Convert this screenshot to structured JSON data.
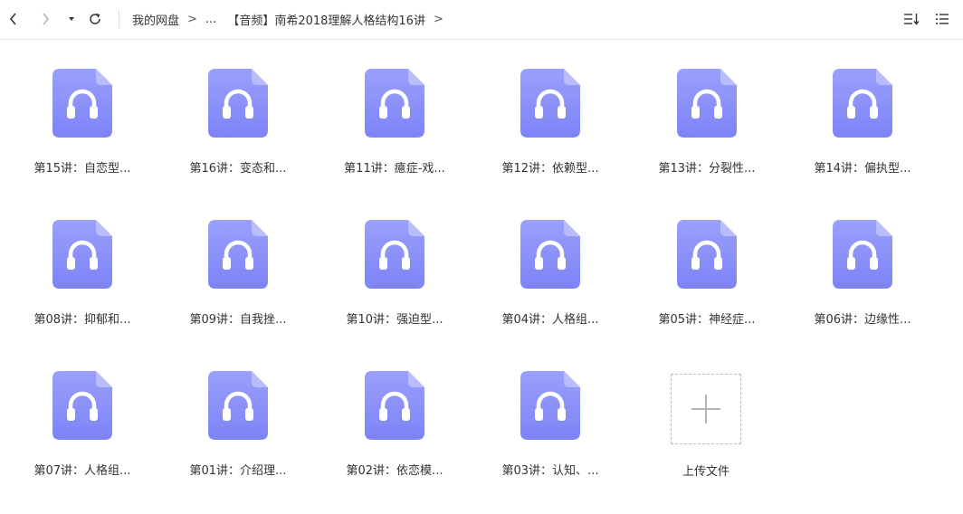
{
  "toolbar": {
    "back_icon": "chevron-left-icon",
    "forward_icon": "chevron-right-icon",
    "dropdown_icon": "caret-down-icon",
    "refresh_icon": "refresh-icon",
    "sort_icon": "sort-icon",
    "view_icon": "list-view-icon"
  },
  "breadcrumb": {
    "root": "我的网盘",
    "separator": ">",
    "ellipsis": "...",
    "current": "【音频】南希2018理解人格结构16讲"
  },
  "files": [
    {
      "name": "第15讲：自恋型..."
    },
    {
      "name": "第16讲：变态和..."
    },
    {
      "name": "第11讲：癔症-戏..."
    },
    {
      "name": "第12讲：依赖型..."
    },
    {
      "name": "第13讲：分裂性..."
    },
    {
      "name": "第14讲：偏执型..."
    },
    {
      "name": "第08讲：抑郁和..."
    },
    {
      "name": "第09讲：自我挫..."
    },
    {
      "name": "第10讲：强迫型..."
    },
    {
      "name": "第04讲：人格组..."
    },
    {
      "name": "第05讲：神经症..."
    },
    {
      "name": "第06讲：边缘性..."
    },
    {
      "name": "第07讲：人格组..."
    },
    {
      "name": "第01讲：介绍理..."
    },
    {
      "name": "第02讲：依恋模..."
    },
    {
      "name": "第03讲：认知、..."
    }
  ],
  "upload": {
    "label": "上传文件",
    "icon": "plus-icon"
  },
  "colors": {
    "file_icon_top": "#9aa0fb",
    "file_icon_bottom": "#7d83f6",
    "file_icon_fold": "#b9bdfd"
  }
}
